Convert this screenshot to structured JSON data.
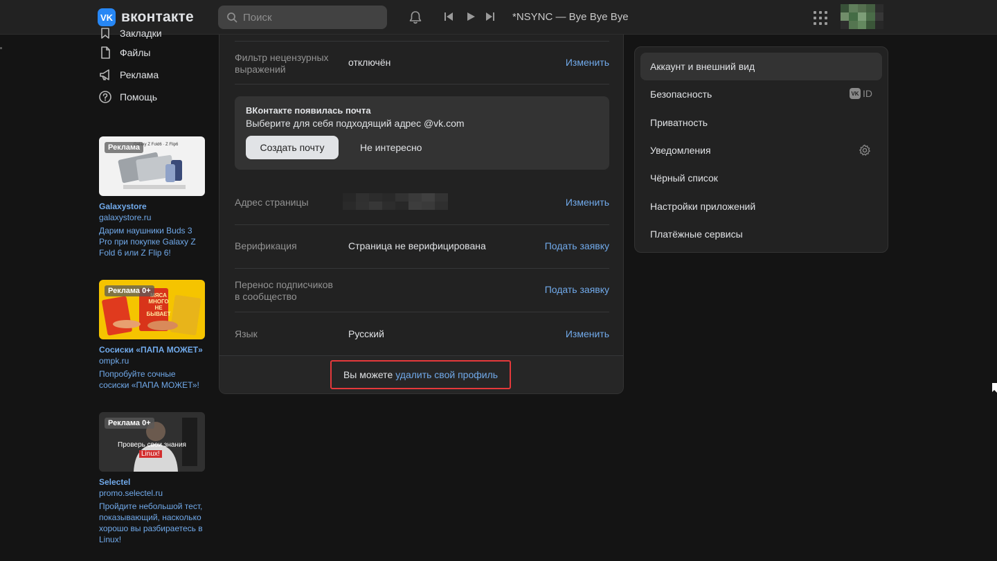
{
  "header": {
    "logo_mark": "VK",
    "logo_text": "вконтакте",
    "search_placeholder": "Поиск",
    "now_playing": "*NSYNC — Bye Bye Bye"
  },
  "left_nav": {
    "items": [
      {
        "label": "Закладки",
        "icon": "bookmark-icon"
      },
      {
        "label": "Файлы",
        "icon": "file-icon"
      },
      {
        "label": "Реклама",
        "icon": "megaphone-icon"
      },
      {
        "label": "Помощь",
        "icon": "help-icon"
      }
    ]
  },
  "ads": [
    {
      "badge": "Реклама",
      "title": "Galaxystore",
      "domain": "galaxystore.ru",
      "text": "Дарим наушники Buds 3 Pro при покупке Galaxy Z Fold 6 или Z Flip 6!",
      "image_text": "Galaxy Z Fold6 · Z Flip6"
    },
    {
      "badge": "Реклама 0+",
      "title": "Сосиски «ПАПА МОЖЕТ»",
      "domain": "ompk.ru",
      "text": "Попробуйте сочные сосиски «ПАПА МОЖЕТ»!",
      "image_text": "МЯСА МНОГО НЕ БЫВАЕТ"
    },
    {
      "badge": "Реклама 0+",
      "title": "Selectel",
      "domain": "promo.selectel.ru",
      "text": "Пройдите небольшой тест, показывающий, насколько хорошо вы разбираетесь в Linux!",
      "image_text_1": "Проверь свои знания",
      "image_text_2": "Linux!"
    }
  ],
  "settings": {
    "filter": {
      "label": "Фильтр нецензурных выражений",
      "value": "отключён",
      "action": "Изменить"
    },
    "mail_promo": {
      "title": "ВКонтакте появилась почта",
      "subtitle": "Выберите для себя подходящий адрес @vk.com",
      "create_button": "Создать почту",
      "dismiss_button": "Не интересно"
    },
    "address": {
      "label": "Адрес страницы",
      "action": "Изменить"
    },
    "verification": {
      "label": "Верификация",
      "value": "Страница не верифицирована",
      "action": "Подать заявку"
    },
    "transfer": {
      "label": "Перенос подписчиков в сообщество",
      "action": "Подать заявку"
    },
    "language": {
      "label": "Язык",
      "value": "Русский",
      "action": "Изменить"
    },
    "delete": {
      "prefix": "Вы можете",
      "link": "удалить свой профиль"
    }
  },
  "right_menu": {
    "items": [
      {
        "label": "Аккаунт и внешний вид",
        "active": true
      },
      {
        "label": "Безопасность",
        "tag": "ID"
      },
      {
        "label": "Приватность"
      },
      {
        "label": "Уведомления"
      },
      {
        "label": "Чёрный список"
      },
      {
        "label": "Настройки приложений"
      },
      {
        "label": "Платёжные сервисы"
      }
    ],
    "vk_mini_text": "VK"
  },
  "colors": {
    "accent": "#71aaeb",
    "brand": "#2787f5",
    "highlight_border": "#e6393b",
    "background": "#141414",
    "panel": "#222222"
  }
}
